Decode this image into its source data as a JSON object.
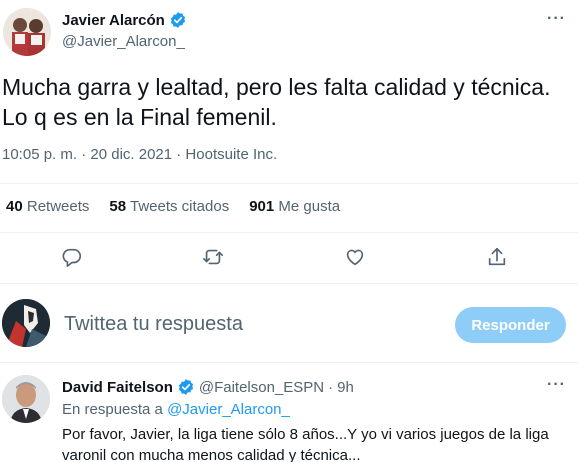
{
  "colors": {
    "accent": "#1d9bf0",
    "muted": "#536471",
    "text": "#0f1419",
    "button_disabled": "#8ecdf8"
  },
  "tweet": {
    "author_name": "Javier Alarcón",
    "author_handle": "@Javier_Alarcon_",
    "text": "Mucha garra y lealtad, pero les falta calidad y técnica. Lo q es en la Final femenil.",
    "meta": "10:05 p. m. · 20 dic. 2021 · Hootsuite Inc.",
    "more_icon": "ellipsis-icon",
    "stats": {
      "retweets_count": "40",
      "retweets_label": "Retweets",
      "quotes_count": "58",
      "quotes_label": "Tweets citados",
      "likes_count": "901",
      "likes_label": "Me gusta"
    },
    "actions": [
      "reply-icon",
      "retweet-icon",
      "like-icon",
      "share-icon"
    ]
  },
  "composer": {
    "placeholder": "Twittea tu respuesta",
    "button_label": "Responder"
  },
  "reply": {
    "author_name": "David Faitelson",
    "author_handle": "@Faitelson_ESPN",
    "separator": "·",
    "time": "9h",
    "replying_prefix": "En respuesta a",
    "replying_to": "@Javier_Alarcon_",
    "text": "Por favor, Javier, la liga tiene sólo 8 años...Y yo vi varios juegos de la liga varonil con mucha menos calidad y técnica..."
  }
}
